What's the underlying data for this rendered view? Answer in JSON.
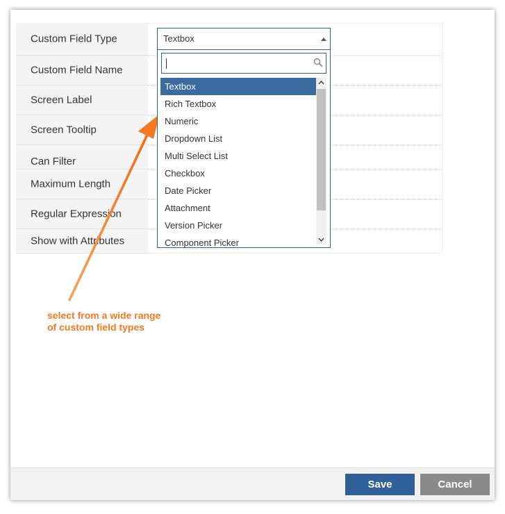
{
  "form": {
    "labels": [
      "Custom Field Type",
      "Custom Field Name",
      "Screen Label",
      "Screen Tooltip",
      "Can Filter",
      "Maximum Length",
      "Regular Expression",
      "Show with Attributes"
    ]
  },
  "field_type_select": {
    "selected": "Textbox",
    "search_value": "",
    "options": [
      "Textbox",
      "Rich Textbox",
      "Numeric",
      "Dropdown List",
      "Multi Select List",
      "Checkbox",
      "Date Picker",
      "Attachment",
      "Version Picker",
      "Component Picker"
    ]
  },
  "annotation": {
    "line1": "select from a wide range",
    "line2": "of custom field types",
    "color": "#f47920"
  },
  "footer": {
    "save_label": "Save",
    "cancel_label": "Cancel"
  },
  "colors": {
    "primary": "#2f6198",
    "selected_option": "#3a6aa0",
    "cancel": "#8a8a8a"
  }
}
